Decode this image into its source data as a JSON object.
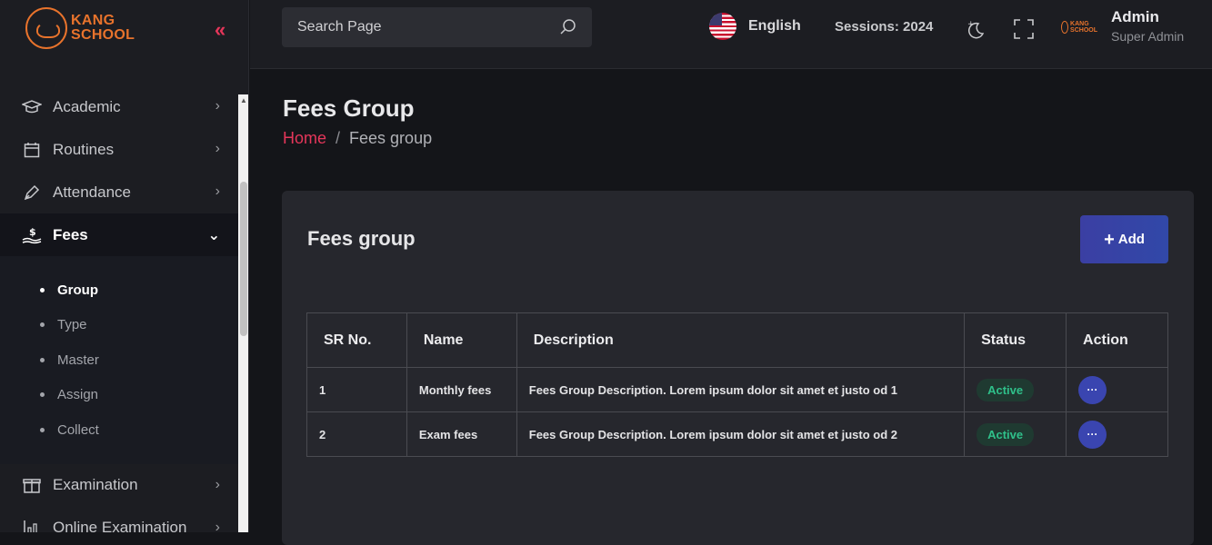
{
  "brand": {
    "line1": "KANG",
    "line2": "SCHOOL",
    "color": "#e8732c"
  },
  "sidebar": {
    "collapse_glyph": "«",
    "items": [
      {
        "label": "Academic",
        "icon": "graduation-cap-icon"
      },
      {
        "label": "Routines",
        "icon": "calendar-icon"
      },
      {
        "label": "Attendance",
        "icon": "pen-icon"
      },
      {
        "label": "Fees",
        "icon": "money-hand-icon",
        "active": true
      },
      {
        "label": "Examination",
        "icon": "gift-box-icon"
      },
      {
        "label": "Online Examination",
        "icon": "chart-icon"
      }
    ],
    "fees_submenu": [
      "Group",
      "Type",
      "Master",
      "Assign",
      "Collect"
    ]
  },
  "topbar": {
    "search_placeholder": "Search Page",
    "language": "English",
    "session": "Sessions: 2024",
    "user_name": "Admin",
    "user_role": "Super Admin",
    "mini_logo_line1": "KANG",
    "mini_logo_line2": "SCHOOL"
  },
  "page": {
    "title": "Fees Group",
    "breadcrumb_home": "Home",
    "breadcrumb_sep": "/",
    "breadcrumb_current": "Fees group"
  },
  "card": {
    "title": "Fees group",
    "add_label": "Add",
    "add_plus": "+",
    "columns": [
      "SR No.",
      "Name",
      "Description",
      "Status",
      "Action"
    ],
    "rows": [
      {
        "sr": "1",
        "name": "Monthly fees",
        "description": "Fees Group Description. Lorem ipsum dolor sit amet et justo od 1",
        "status": "Active",
        "action": "···"
      },
      {
        "sr": "2",
        "name": "Exam fees",
        "description": "Fees Group Description. Lorem ipsum dolor sit amet et justo od 2",
        "status": "Active",
        "action": "···"
      }
    ]
  },
  "colors": {
    "accent": "#e5365a",
    "primary": "#3b3fa3",
    "status_active": "#2fc08a",
    "background": "#141519",
    "panel": "#26272d"
  }
}
